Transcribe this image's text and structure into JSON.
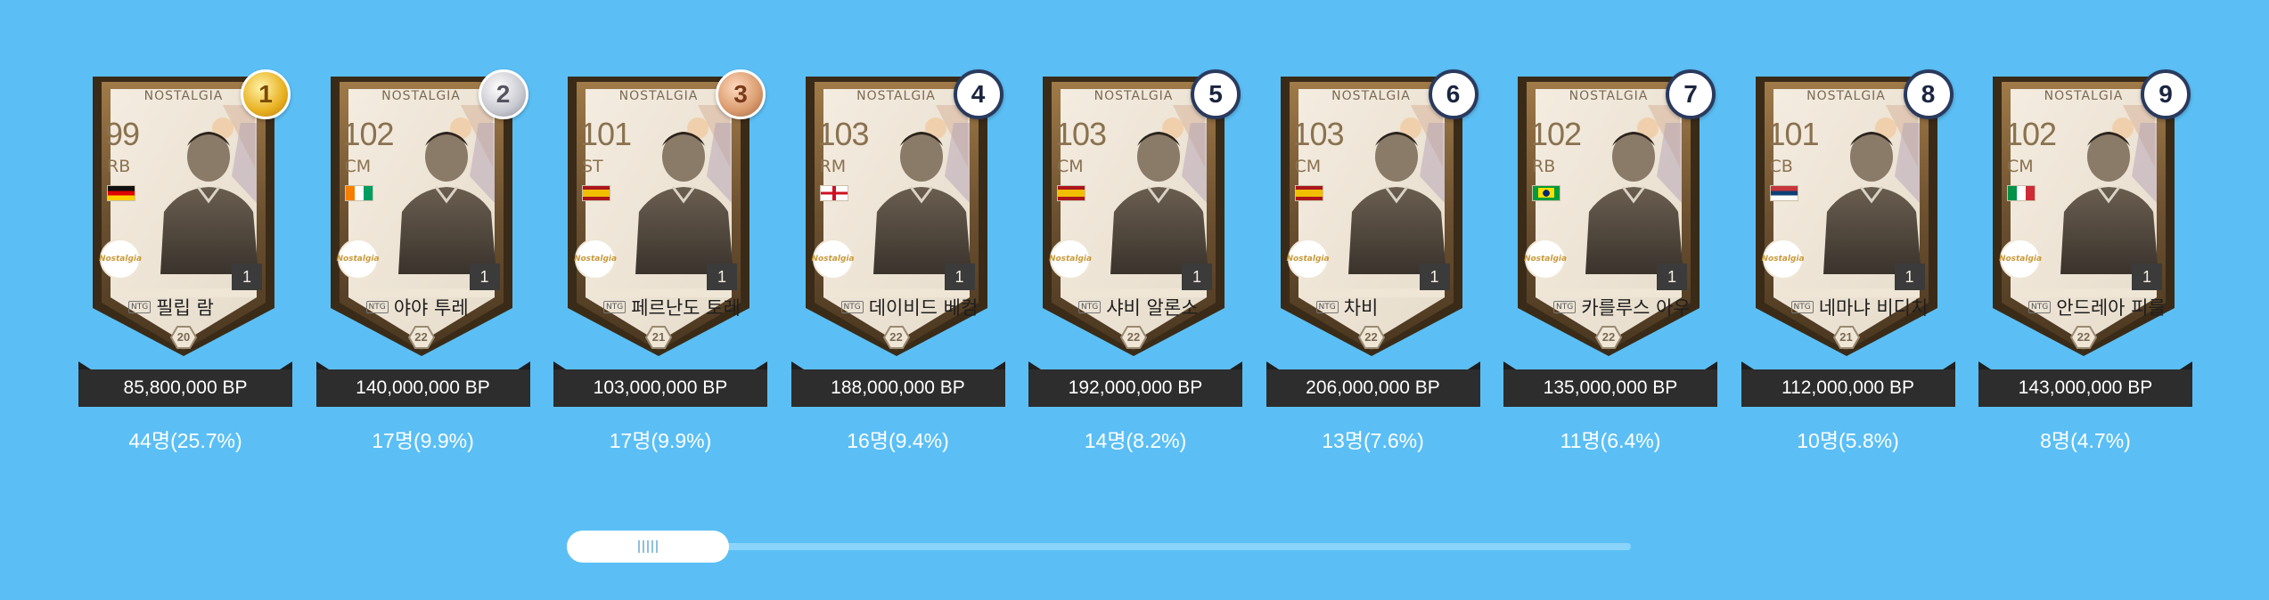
{
  "card_label": "NOSTALGIA",
  "ntg_badge": "NTG",
  "logo_text": "Nostalgia",
  "colors": {
    "background": "#5bbff5",
    "price_bar": "#2d2d2d",
    "card_frame": "#8a6a40",
    "gold": "#e8b020",
    "silver": "#c0c0c8",
    "bronze": "#d99a6c"
  },
  "players": [
    {
      "rank": "1",
      "rank_style": "gold",
      "ovr": "99",
      "pos": "RB",
      "flag": "germany",
      "grade": "1",
      "name": "필립 람",
      "season": "20",
      "price": "85,800,000 BP",
      "count": "44명(25.7%)"
    },
    {
      "rank": "2",
      "rank_style": "silver",
      "ovr": "102",
      "pos": "CM",
      "flag": "ivory-coast",
      "grade": "1",
      "name": "야야 투레",
      "season": "22",
      "price": "140,000,000 BP",
      "count": "17명(9.9%)"
    },
    {
      "rank": "3",
      "rank_style": "bronze",
      "ovr": "101",
      "pos": "ST",
      "flag": "spain",
      "grade": "1",
      "name": "페르난도 토레스",
      "season": "21",
      "price": "103,000,000 BP",
      "count": "17명(9.9%)"
    },
    {
      "rank": "4",
      "rank_style": "plain",
      "ovr": "103",
      "pos": "RM",
      "flag": "england",
      "grade": "1",
      "name": "데이비드 베컴",
      "season": "22",
      "price": "188,000,000 BP",
      "count": "16명(9.4%)"
    },
    {
      "rank": "5",
      "rank_style": "plain",
      "ovr": "103",
      "pos": "CM",
      "flag": "spain",
      "grade": "1",
      "name": "샤비 알론소",
      "season": "22",
      "price": "192,000,000 BP",
      "count": "14명(8.2%)"
    },
    {
      "rank": "6",
      "rank_style": "plain",
      "ovr": "103",
      "pos": "CM",
      "flag": "spain",
      "grade": "1",
      "name": "차비",
      "season": "22",
      "price": "206,000,000 BP",
      "count": "13명(7.6%)"
    },
    {
      "rank": "7",
      "rank_style": "plain",
      "ovr": "102",
      "pos": "RB",
      "flag": "brazil",
      "grade": "1",
      "name": "카를루스 아우베",
      "season": "22",
      "price": "135,000,000 BP",
      "count": "11명(6.4%)"
    },
    {
      "rank": "8",
      "rank_style": "plain",
      "ovr": "101",
      "pos": "CB",
      "flag": "serbia",
      "grade": "1",
      "name": "네마냐 비디치",
      "season": "21",
      "price": "112,000,000 BP",
      "count": "10명(5.8%)"
    },
    {
      "rank": "9",
      "rank_style": "plain",
      "ovr": "102",
      "pos": "CM",
      "flag": "italy",
      "grade": "1",
      "name": "안드레아 피를로",
      "season": "22",
      "price": "143,000,000 BP",
      "count": "8명(4.7%)"
    }
  ],
  "scrollbar": {
    "position": 0.0
  }
}
